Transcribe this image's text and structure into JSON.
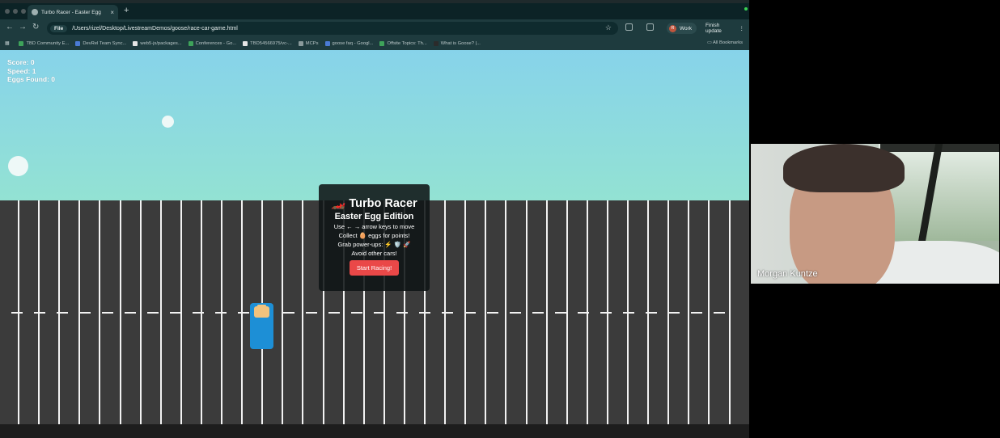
{
  "browser": {
    "tab_title": "Turbo Racer - Easter Egg",
    "address_chip": "File",
    "address_url": "/Users/rizel/Desktop/LivestreamDemos/goose/race-car-game.html",
    "profile_label": "Work",
    "finish_update_label": "Finish update",
    "bookmarks": [
      {
        "label": "TBD Community E...",
        "color": "#3ea35a"
      },
      {
        "label": "DevRel Team Sync...",
        "color": "#4a7bd6"
      },
      {
        "label": "web5-js/packages...",
        "color": "#e6e6e6"
      },
      {
        "label": "Conferences - Go...",
        "color": "#3ea35a"
      },
      {
        "label": "TBD54566975/vc-...",
        "color": "#e6e6e6"
      },
      {
        "label": "MCPs",
        "color": "#8a9a9b"
      },
      {
        "label": "goose faq - Googl...",
        "color": "#4a7bd6"
      },
      {
        "label": "Offsite Topics: Th...",
        "color": "#3ea35a"
      },
      {
        "label": "What is Goose? |...",
        "color": "#2b2b2b"
      }
    ],
    "all_bookmarks_label": "All Bookmarks"
  },
  "game": {
    "hud": {
      "score": "Score: 0",
      "speed": "Speed: 1",
      "eggs": "Eggs Found: 0"
    },
    "modal": {
      "title": "🏎️ Turbo Racer",
      "subtitle": "Easter Egg Edition",
      "line1": "Use ← → arrow keys to move",
      "line2": "Collect 🥚 eggs for points!",
      "line3": "Grab power-ups: ⚡ 🛡️ 🚀",
      "line4": "Avoid other cars!",
      "start_button": "Start Racing!"
    },
    "colors": {
      "road": "#3b3b3b",
      "car": "#1d8fd6",
      "start_button": "#ea4848"
    }
  },
  "video_call": {
    "participant_name": "Morgan Kuntze"
  }
}
